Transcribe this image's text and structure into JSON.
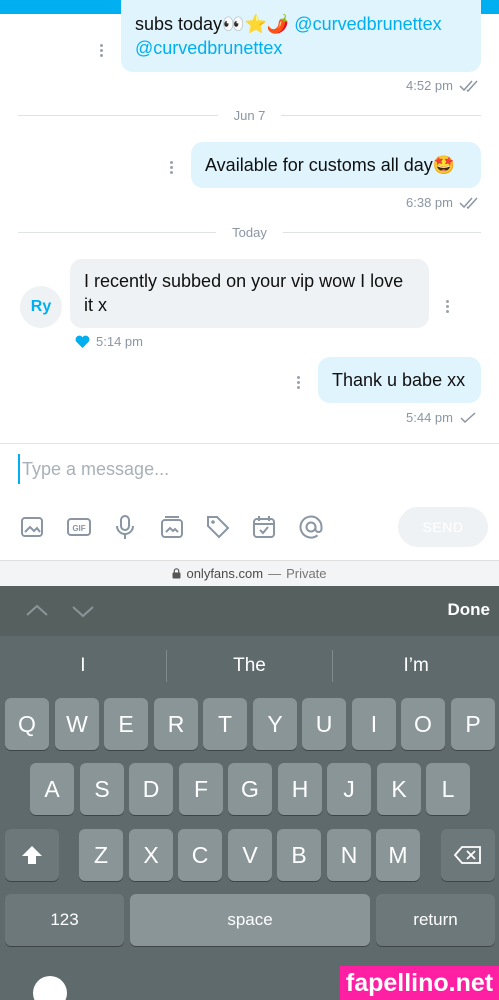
{
  "messages": [
    {
      "text": "subs today👀⭐🌶️ ",
      "mention1": "@curvedbrunettex",
      "mention2": "@curvedbrunettex",
      "time": "4:52 pm"
    },
    {
      "text": "Available for customs all day🤩",
      "time": "6:38 pm"
    },
    {
      "text": "I recently subbed on your vip wow I love it x",
      "time": "5:14 pm",
      "sender_initials": "Ry"
    },
    {
      "text": "Thank u babe xx",
      "time": "5:44 pm"
    }
  ],
  "separators": [
    "Jun 7",
    "Today"
  ],
  "composer": {
    "placeholder": "Type a message...",
    "send_label": "SEND"
  },
  "toolbar_icons": [
    "image-icon",
    "gif-icon",
    "microphone-icon",
    "media-vault-icon",
    "price-tag-icon",
    "calendar-icon",
    "mention-icon"
  ],
  "url_bar": {
    "domain": "onlyfans.com",
    "separator": " — ",
    "privacy": "Private"
  },
  "keyboard": {
    "done_label": "Done",
    "suggestions": [
      "I",
      "The",
      "I’m"
    ],
    "row1": [
      "Q",
      "W",
      "E",
      "R",
      "T",
      "Y",
      "U",
      "I",
      "O",
      "P"
    ],
    "row2": [
      "A",
      "S",
      "D",
      "F",
      "G",
      "H",
      "J",
      "K",
      "L"
    ],
    "row3": [
      "Z",
      "X",
      "C",
      "V",
      "B",
      "N",
      "M"
    ],
    "numbers_label": "123",
    "space_label": "space",
    "return_label": "return"
  },
  "watermark": "fapellino.net",
  "colors": {
    "accent": "#00aff0",
    "watermark": "#ff1fa3"
  }
}
